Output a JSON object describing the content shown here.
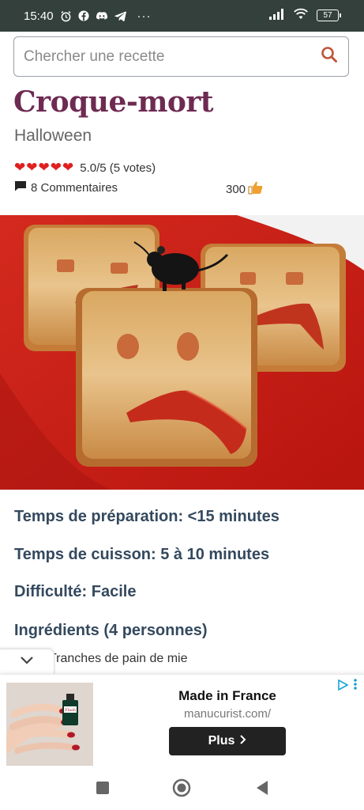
{
  "status_bar": {
    "time": "15:40",
    "battery": "57",
    "icons": [
      "alarm-icon",
      "facebook-icon",
      "discord-icon",
      "telegram-icon",
      "more-icon",
      "signal-icon",
      "wifi-icon",
      "battery-icon"
    ],
    "more": "···"
  },
  "search": {
    "placeholder": "Chercher une recette",
    "icon": "search-icon",
    "accent": "#c0563c"
  },
  "recipe": {
    "title": "Croque-mort",
    "category": "Halloween",
    "rating": "5.0/5 (5 votes)",
    "rating_value": 5,
    "comments": "8 Commentaires",
    "likes": "300",
    "title_color": "#6e2b52"
  },
  "details": {
    "prep_time": "Temps de préparation: <15 minutes",
    "cook_time": "Temps de cuisson: 5 à 10 minutes",
    "difficulty": "Difficulté: Facile",
    "ingredients_heading": "Ingrédients (4 personnes)",
    "ingredient_1": "Tranches de pain de mie"
  },
  "ad": {
    "title": "Made in France",
    "url": "manucurist.com/",
    "button": "Plus",
    "bottle_label": "Flash"
  },
  "nav": {
    "icons": [
      "recent-apps-icon",
      "home-icon",
      "back-icon"
    ]
  }
}
